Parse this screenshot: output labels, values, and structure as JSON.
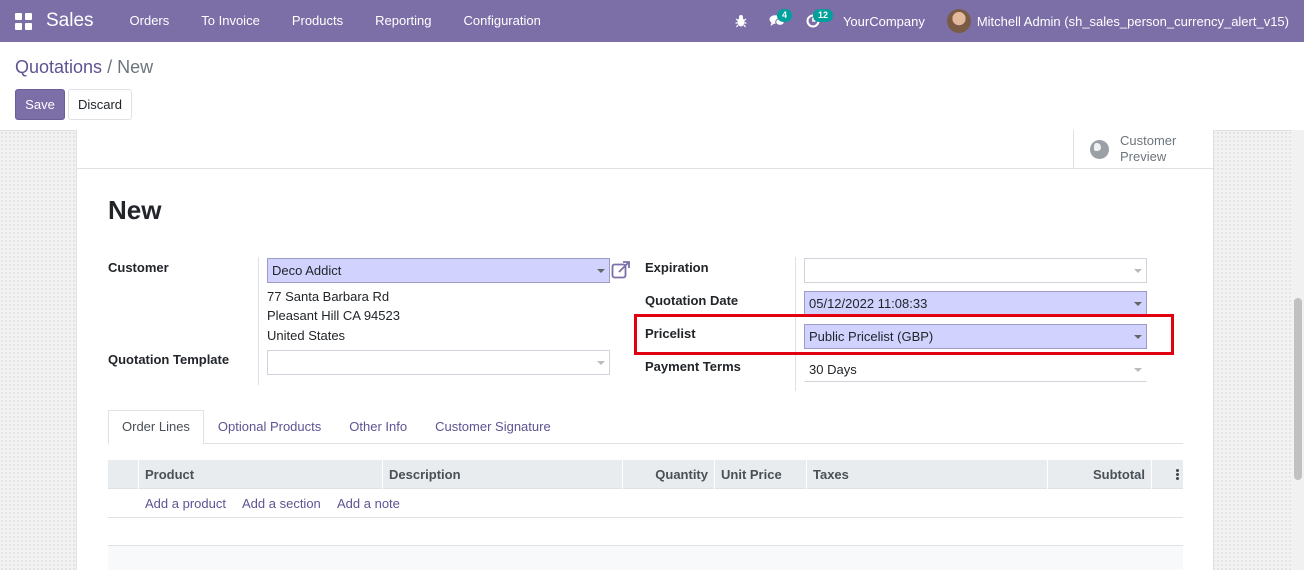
{
  "navbar": {
    "app_name": "Sales",
    "menu": [
      "Orders",
      "To Invoice",
      "Products",
      "Reporting",
      "Configuration"
    ],
    "messages_count": "4",
    "activities_count": "12",
    "company": "YourCompany",
    "user": "Mitchell Admin (sh_sales_person_currency_alert_v15)"
  },
  "breadcrumb": {
    "parent": "Quotations",
    "separator": " / ",
    "current": "New"
  },
  "actions": {
    "save_label": "Save",
    "discard_label": "Discard"
  },
  "button_box": {
    "preview_line1": "Customer",
    "preview_line2": "Preview"
  },
  "form": {
    "title": "New",
    "customer_label": "Customer",
    "customer_value": "Deco Addict",
    "address": [
      "77 Santa Barbara Rd",
      "Pleasant Hill CA 94523",
      "United States"
    ],
    "template_label": "Quotation Template",
    "template_value": "",
    "expiration_label": "Expiration",
    "expiration_value": "",
    "date_label": "Quotation Date",
    "date_value": "05/12/2022 11:08:33",
    "pricelist_label": "Pricelist",
    "pricelist_value": "Public Pricelist (GBP)",
    "terms_label": "Payment Terms",
    "terms_value": "30 Days"
  },
  "tabs": [
    "Order Lines",
    "Optional Products",
    "Other Info",
    "Customer Signature"
  ],
  "table": {
    "columns": [
      "Product",
      "Description",
      "Quantity",
      "Unit Price",
      "Taxes",
      "Subtotal"
    ],
    "add_links": [
      "Add a product",
      "Add a section",
      "Add a note"
    ]
  },
  "colors": {
    "brand": "#7c6ea7",
    "required_field": "#d2d2ff",
    "highlight": "#e0000f",
    "badge": "#00a09d"
  }
}
